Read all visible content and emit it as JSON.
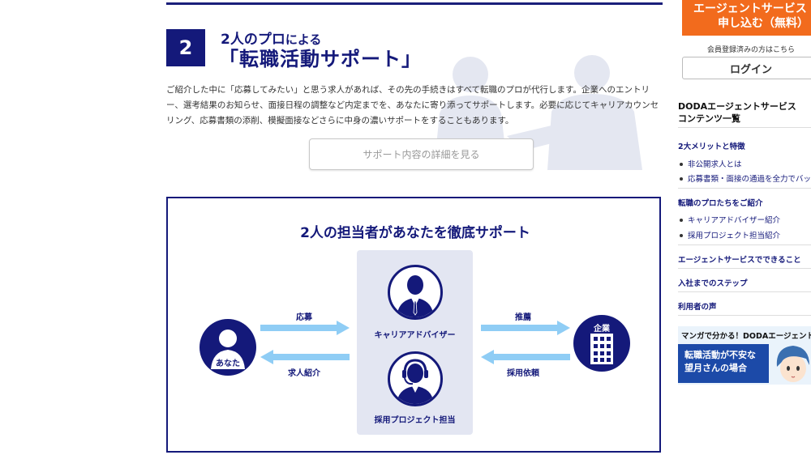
{
  "section": {
    "number": "2",
    "subtitle_main": "2人のプロ",
    "subtitle_suffix": "による",
    "title": "「転職活動サポート」",
    "description": "ご紹介した中に「応募してみたい」と思う求人があれば、その先の手続きはすべて転職のプロが代行します。企業へのエントリー、選考結果のお知らせ、面接日程の調整など内定までを、あなたに寄り添ってサポートします。必要に応じてキャリアカウンセリング、応募書類の添削、模擬面接などさらに中身の濃いサポートをすることもあります。",
    "detail_button": "サポート内容の詳細を見る"
  },
  "diagram": {
    "title": "2人の担当者があなたを徹底サポート",
    "you_label": "あなた",
    "company_label": "企業",
    "advisor_label": "キャリアアドバイザー",
    "project_label": "採用プロジェクト担当",
    "arrow_apply": "応募",
    "arrow_jobs": "求人紹介",
    "arrow_recommend": "推薦",
    "arrow_request": "採用依頼"
  },
  "sidebar": {
    "cta_line1": "エージェントサービス",
    "cta_line2": "申し込む（無料）",
    "member_note": "会員登録済みの方はこちら",
    "login": "ログイン",
    "contents_title_1": "DODAエージェントサービス",
    "contents_title_2": "コンテンツ一覧",
    "groups": [
      {
        "head": "2大メリットと特徴",
        "items": [
          "非公開求人とは",
          "応募書類・面接の通過を全力でバック"
        ]
      },
      {
        "head": "転職のプロたちをご紹介",
        "items": [
          "キャリアアドバイザー紹介",
          "採用プロジェクト担当紹介"
        ]
      },
      {
        "head": "エージェントサービスでできること",
        "items": []
      },
      {
        "head": "入社までのステップ",
        "items": []
      },
      {
        "head": "利用者の声",
        "items": []
      }
    ],
    "manga_head": "マンガで分かる！DODAエージェントサ",
    "manga_line1": "転職活動が不安な",
    "manga_line2": "望月さんの場合"
  },
  "colors": {
    "navy": "#14197a",
    "orange": "#f26b1d",
    "arrow": "#8fcdf5",
    "panel": "#e3e6f2"
  }
}
